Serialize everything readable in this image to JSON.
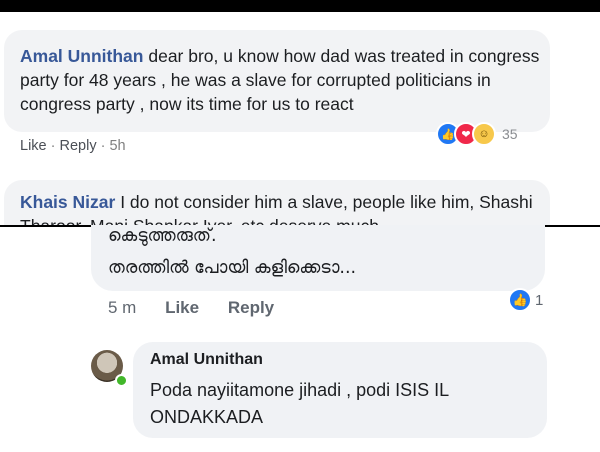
{
  "top_ghost": "",
  "comment1": {
    "author": "Amal Unnithan",
    "text": "dear bro, u know how dad was treated in congress party for 48 years , he was a slave for corrupted politicians in congress party , now its time for us to react",
    "like": "Like",
    "reply": "Reply",
    "time": "5h",
    "reaction_count": "35",
    "reactions": [
      "like-icon",
      "love-icon",
      "haha-icon"
    ]
  },
  "comment2": {
    "author": "Khais Nizar",
    "text": "I do not consider him a slave, people like him, Shashi Tharoor, Mani Shankar Iyer, etc deserve much"
  },
  "comment3": {
    "line1": "കെടുത്തരുത്.",
    "line2": "തരത്തിൽ പോയി കളിക്കെടാ...",
    "time": "5 m",
    "like": "Like",
    "reply": "Reply",
    "reaction_count": "1"
  },
  "comment4": {
    "author": "Amal Unnithan",
    "text": "Poda nayiitamone jihadi , podi ISIS IL ONDAKKADA"
  },
  "colors": {
    "fb_link": "#385898",
    "like_blue": "#2078f4",
    "love_red": "#f0284a",
    "haha_yellow": "#f7c84b",
    "online_green": "#42b72a"
  }
}
